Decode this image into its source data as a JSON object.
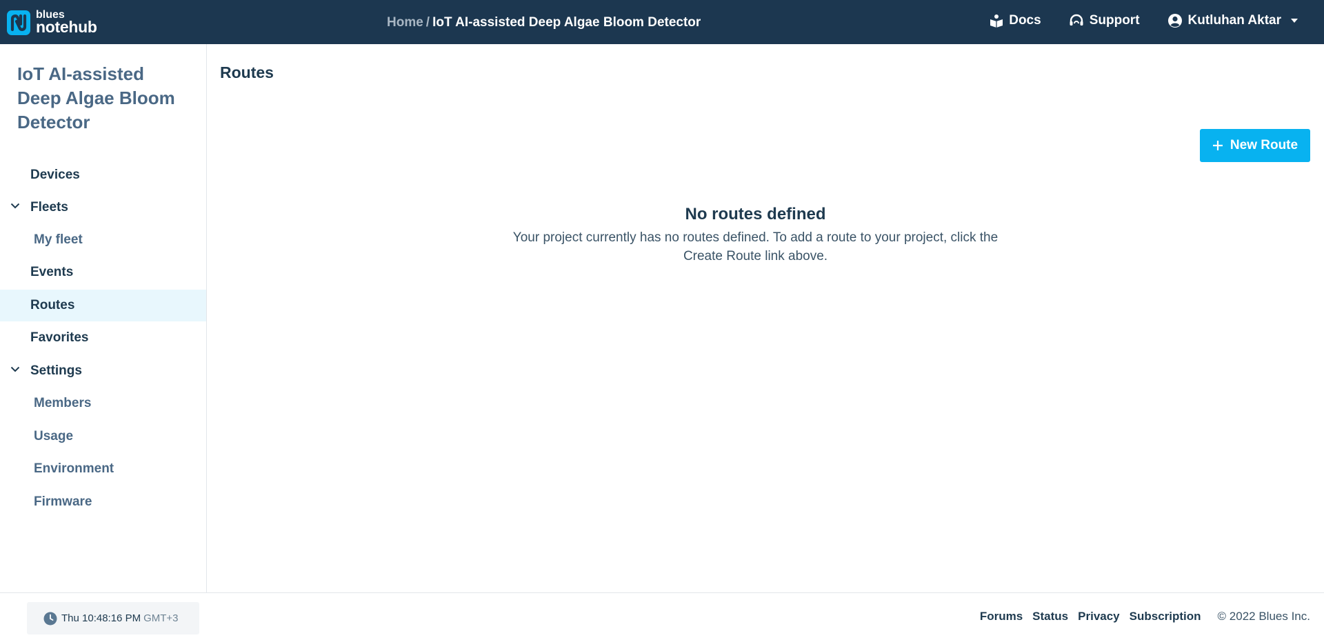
{
  "brand": {
    "small": "blues",
    "big": "notehub",
    "accent": "#08b2f0"
  },
  "header": {
    "breadcrumb_home": "Home",
    "breadcrumb_sep": "/",
    "breadcrumb_current": "IoT AI-assisted Deep Algae Bloom Detector",
    "docs_label": "Docs",
    "support_label": "Support",
    "user_name": "Kutluhan Aktar",
    "icons": {
      "docs": "book-icon",
      "support": "headset-icon",
      "user": "user-circle-icon"
    }
  },
  "sidebar": {
    "project_title": "IoT AI-assisted Deep Algae Bloom Detector",
    "items": [
      {
        "label": "Devices"
      },
      {
        "label": "Fleets",
        "expandable": true
      },
      {
        "label": "My fleet",
        "sub": true
      },
      {
        "label": "Events"
      },
      {
        "label": "Routes",
        "active": true
      },
      {
        "label": "Favorites"
      },
      {
        "label": "Settings",
        "expandable": true
      },
      {
        "label": "Members",
        "sub": true
      },
      {
        "label": "Usage",
        "sub": true
      },
      {
        "label": "Environment",
        "sub": true
      },
      {
        "label": "Firmware",
        "sub": true
      }
    ]
  },
  "main": {
    "page_title": "Routes",
    "new_route_label": "New Route",
    "empty_title": "No routes defined",
    "empty_desc": "Your project currently has no routes defined. To add a route to your project, click the Create Route link above."
  },
  "footer": {
    "time": "Thu 10:48:16 PM",
    "timezone": "GMT+3",
    "links": [
      "Forums",
      "Status",
      "Privacy",
      "Subscription"
    ],
    "copyright": "© 2022 Blues Inc."
  }
}
